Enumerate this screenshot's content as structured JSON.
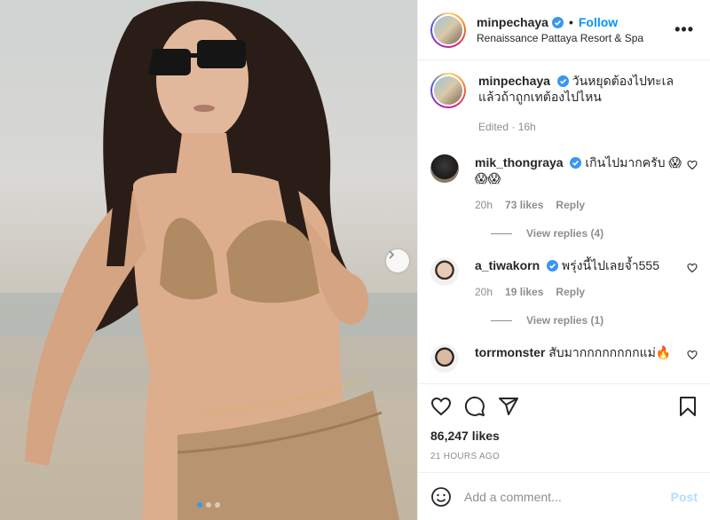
{
  "post": {
    "author": "minpechaya",
    "follow_label": "Follow",
    "separator": "•",
    "location": "Renaissance Pattaya Resort & Spa",
    "more_icon": "more-options-icon",
    "caption": {
      "user": "minpechaya",
      "text": "วันหยุดต้องไปทะเล แล้วถ้าถูกเทต้องไปไหน",
      "meta": "Edited · 16h"
    },
    "comments": [
      {
        "user": "mik_thongraya",
        "verified": true,
        "text": "เกินไปมากครับ 😱😱😱",
        "time": "20h",
        "likes": "73 likes",
        "reply": "Reply",
        "view_replies": "View replies (4)"
      },
      {
        "user": "a_tiwakorn",
        "verified": true,
        "text": "พรุ่งนี้ไปเลยจ้ำ555",
        "time": "20h",
        "likes": "19 likes",
        "reply": "Reply",
        "view_replies": "View replies (1)"
      },
      {
        "user": "torrmonster",
        "verified": false,
        "text": "สับมากกกกกกกกแม่🔥"
      }
    ],
    "likes": "86,247 likes",
    "timestamp": "21 HOURS AGO",
    "add_comment": {
      "placeholder": "Add a comment...",
      "post_label": "Post"
    },
    "carousel": {
      "total_slides": 3,
      "active_slide": 1
    },
    "colors": {
      "accent": "#0095f6",
      "verified": "#3897f0",
      "post_disabled": "#b2dffc",
      "meta_gray": "#8e8e8e"
    }
  }
}
